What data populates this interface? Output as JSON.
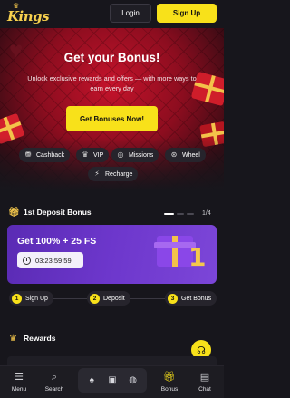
{
  "header": {
    "logo_text": "Kings",
    "login_label": "Login",
    "signup_label": "Sign Up"
  },
  "hero": {
    "title": "Get your Bonus!",
    "subtitle": "Unlock exclusive rewards and offers — with more ways to earn every day",
    "cta_label": "Get Bonuses Now!"
  },
  "quick_links": [
    {
      "label": "Cashback",
      "icon": "cashback-icon"
    },
    {
      "label": "VIP",
      "icon": "crown-icon"
    },
    {
      "label": "Missions",
      "icon": "target-icon"
    },
    {
      "label": "Wheel",
      "icon": "wheel-icon"
    },
    {
      "label": "Recharge",
      "icon": "recharge-icon"
    }
  ],
  "deposit_section": {
    "title": "1st Deposit Bonus",
    "pager": "1/4",
    "card_title": "Get 100% + 25 FS",
    "timer": "03:23:59:59",
    "steps": [
      {
        "num": "1",
        "label": "Sign Up"
      },
      {
        "num": "2",
        "label": "Deposit"
      },
      {
        "num": "3",
        "label": "Get Bonus"
      }
    ]
  },
  "rewards_section": {
    "title": "Rewards"
  },
  "bottom_nav": {
    "menu": "Menu",
    "search": "Search",
    "bonus": "Bonus",
    "chat": "Chat"
  },
  "colors": {
    "accent": "#f8e11a",
    "background": "#17161c",
    "card": "#6d37cc",
    "hero": "#c5132b"
  }
}
